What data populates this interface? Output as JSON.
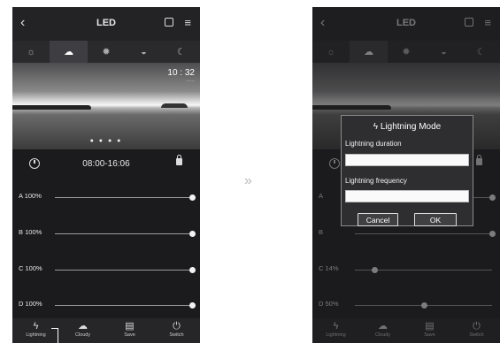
{
  "screen_left": {
    "title": "LED",
    "clock": {
      "time": "10 : 32",
      "sub": "......"
    },
    "schedule": "08:00-16:06",
    "channels": [
      {
        "name": "A",
        "value": "100%",
        "level": 1.0
      },
      {
        "name": "B",
        "value": "100%",
        "level": 1.0
      },
      {
        "name": "C",
        "value": "100%",
        "level": 1.0
      },
      {
        "name": "D",
        "value": "100%",
        "level": 1.0
      }
    ],
    "nav": [
      "Lightning",
      "Cloudy",
      "Save",
      "Switch"
    ]
  },
  "arrow": "»",
  "screen_right": {
    "title": "LED",
    "channels": [
      {
        "name": "A",
        "value": "",
        "level": 1.0
      },
      {
        "name": "B",
        "value": "",
        "level": 1.0
      },
      {
        "name": "C",
        "value": "14%",
        "level": 0.14
      },
      {
        "name": "D",
        "value": "50%",
        "level": 0.5
      }
    ],
    "dialog": {
      "title": "Lightning Mode",
      "duration_label": "Lightning duration",
      "duration_placeholder": "",
      "frequency_label": "Lightning frequency",
      "frequency_placeholder": "",
      "cancel": "Cancel",
      "ok": "OK"
    },
    "nav": [
      "Lightning",
      "Cloudy",
      "Save",
      "Switch"
    ]
  },
  "icons": {
    "modes": [
      "sunrise-icon",
      "sun-cloud-icon",
      "sun-icon",
      "sunset-icon",
      "moon-icon"
    ],
    "nav": [
      "lightning-icon",
      "cloud-icon",
      "save-icon",
      "power-icon"
    ]
  },
  "colors": {
    "phone_bg": "#1b1b1d",
    "accent": "#f2f2f2"
  }
}
